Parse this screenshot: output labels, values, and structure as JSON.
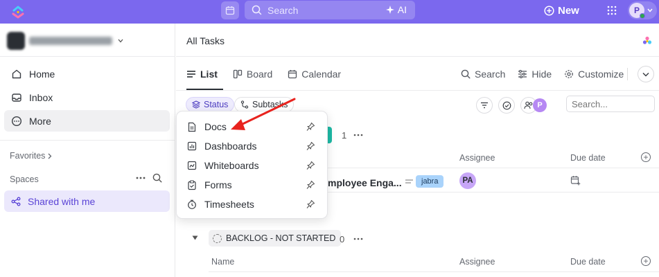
{
  "topbar": {
    "search_placeholder": "Search",
    "ai_label": "AI",
    "new_label": "New",
    "user_initial": "P",
    "brand_color": "#7b68ee"
  },
  "sidebar": {
    "nav": [
      {
        "label": "Home",
        "icon": "home-icon"
      },
      {
        "label": "Inbox",
        "icon": "inbox-icon"
      },
      {
        "label": "More",
        "icon": "more-circle-icon"
      }
    ],
    "favorites_label": "Favorites",
    "spaces_label": "Spaces",
    "shared_label": "Shared with me"
  },
  "main": {
    "title": "All Tasks",
    "tabs": [
      {
        "label": "List",
        "icon": "list-icon",
        "active": true
      },
      {
        "label": "Board",
        "icon": "board-icon"
      },
      {
        "label": "Calendar",
        "icon": "calendar-icon"
      }
    ],
    "actions": [
      {
        "label": "Search",
        "icon": "search-icon"
      },
      {
        "label": "Hide",
        "icon": "sliders-icon"
      },
      {
        "label": "Customize",
        "icon": "gear-icon"
      }
    ],
    "filters": {
      "status_label": "Status",
      "subtasks_label": "Subtasks",
      "assignee_initial": "P",
      "search_placeholder": "Search..."
    },
    "group1": {
      "count": "1",
      "columns": {
        "assignee": "Assignee",
        "due": "Due date"
      },
      "task": {
        "name": "mployee Enga...",
        "tag": "jabra",
        "assignee": "PA"
      }
    },
    "group2": {
      "status": "BACKLOG - NOT STARTED",
      "count": "0",
      "columns": {
        "name": "Name",
        "assignee": "Assignee",
        "due": "Due date"
      }
    }
  },
  "dropdown": {
    "items": [
      {
        "label": "Docs",
        "icon": "doc-icon"
      },
      {
        "label": "Dashboards",
        "icon": "dashboard-icon"
      },
      {
        "label": "Whiteboards",
        "icon": "whiteboard-icon"
      },
      {
        "label": "Forms",
        "icon": "form-icon"
      },
      {
        "label": "Timesheets",
        "icon": "timesheet-icon"
      }
    ]
  }
}
